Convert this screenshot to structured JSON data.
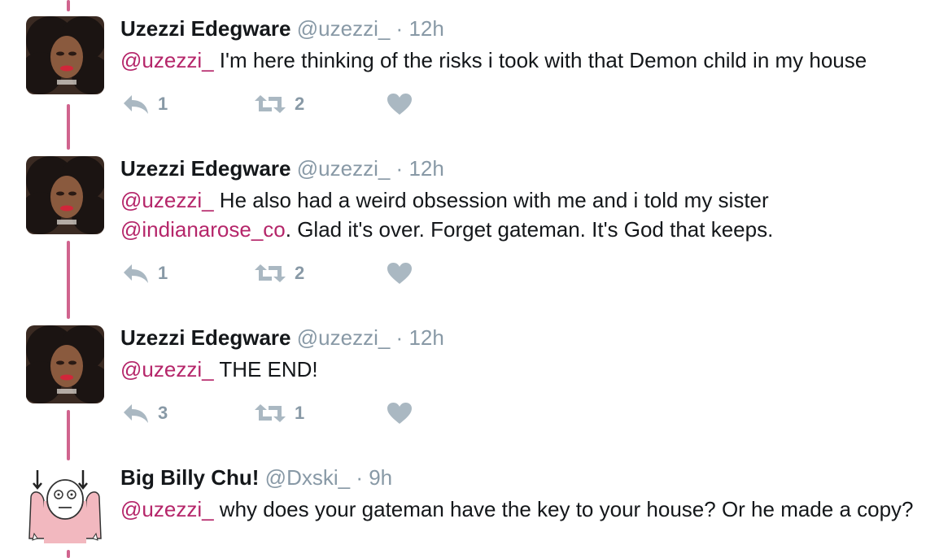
{
  "tweets": [
    {
      "name": "Uzezzi Edegware",
      "handle": "@uzezzi_",
      "dot": "·",
      "time": "12h",
      "mention1": "@uzezzi_",
      "text1": " I'm here thinking of the risks i took with that Demon child in my house",
      "replies": "1",
      "retweets": "2"
    },
    {
      "name": "Uzezzi Edegware",
      "handle": "@uzezzi_",
      "dot": "·",
      "time": "12h",
      "mention1": "@uzezzi_",
      "text1": " He also had a weird obsession with me and i told my sister ",
      "mention2": "@indianarose_co",
      "text2": ". Glad it's over. Forget gateman. It's God that keeps.",
      "replies": "1",
      "retweets": "2"
    },
    {
      "name": "Uzezzi Edegware",
      "handle": "@uzezzi_",
      "dot": "·",
      "time": "12h",
      "mention1": "@uzezzi_",
      "text1": " THE END!",
      "replies": "3",
      "retweets": "1"
    },
    {
      "name": "Big Billy Chu!",
      "handle": "@Dxski_",
      "dot": "·",
      "time": "9h",
      "mention1": "@uzezzi_",
      "text1": " why does your gateman have the key to your house? Or he made a copy?"
    }
  ],
  "icons": {
    "reply": "reply-icon",
    "retweet": "retweet-icon",
    "like": "heart-icon"
  },
  "colors": {
    "thread_line": "#d0648e",
    "mention": "#b5266a",
    "muted": "#8899a6",
    "action_icon": "#aab8c2"
  }
}
